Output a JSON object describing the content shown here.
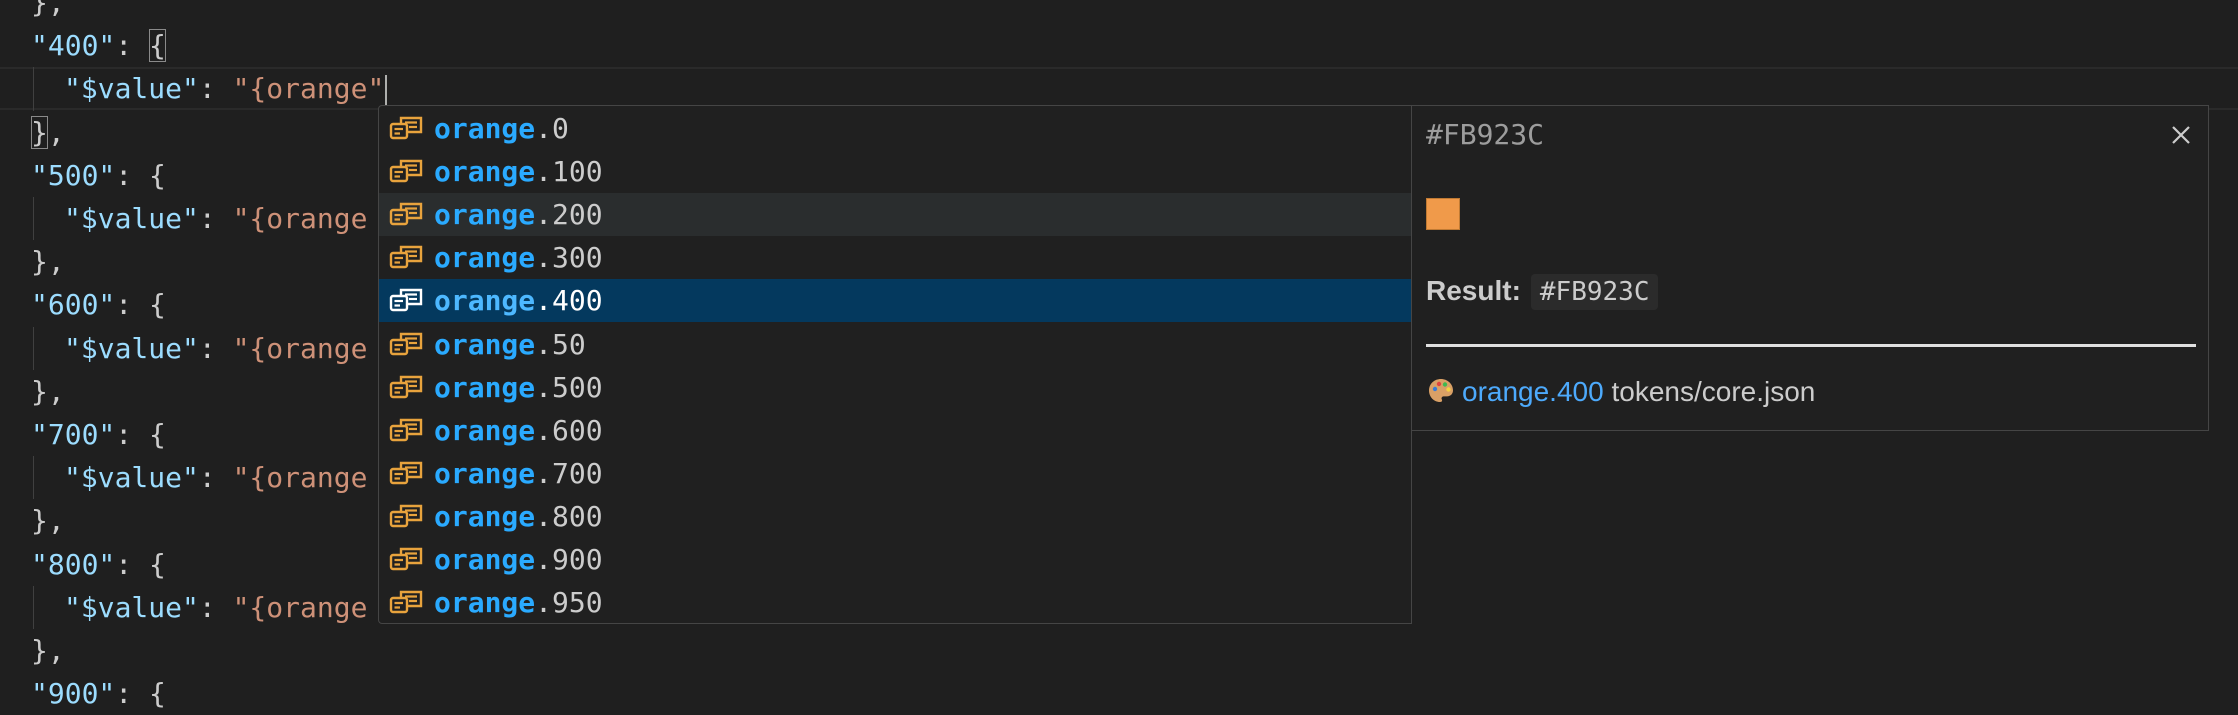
{
  "editor": {
    "lines": [
      {
        "kind": "close",
        "text": "},"
      },
      {
        "kind": "key",
        "key": "\"400\"",
        "sep": ": ",
        "brace": "{"
      },
      {
        "kind": "value",
        "vkey": "\"$value\"",
        "sep": ": ",
        "vstr": "\"{orange\""
      },
      {
        "kind": "close",
        "text": "},"
      },
      {
        "kind": "key",
        "key": "\"500\"",
        "sep": ": ",
        "brace": "{"
      },
      {
        "kind": "value",
        "vkey": "\"$value\"",
        "sep": ": ",
        "vstr": "\"{orange"
      },
      {
        "kind": "close",
        "text": "},"
      },
      {
        "kind": "key",
        "key": "\"600\"",
        "sep": ": ",
        "brace": "{"
      },
      {
        "kind": "value",
        "vkey": "\"$value\"",
        "sep": ": ",
        "vstr": "\"{orange"
      },
      {
        "kind": "close",
        "text": "},"
      },
      {
        "kind": "key",
        "key": "\"700\"",
        "sep": ": ",
        "brace": "{"
      },
      {
        "kind": "value",
        "vkey": "\"$value\"",
        "sep": ": ",
        "vstr": "\"{orange"
      },
      {
        "kind": "close",
        "text": "},"
      },
      {
        "kind": "key",
        "key": "\"800\"",
        "sep": ": ",
        "brace": "{"
      },
      {
        "kind": "value",
        "vkey": "\"$value\"",
        "sep": ": ",
        "vstr": "\"{orange"
      },
      {
        "kind": "close",
        "text": "},"
      },
      {
        "kind": "key",
        "key": "\"900\"",
        "sep": ": ",
        "brace": "{"
      }
    ]
  },
  "suggest": {
    "match": "orange",
    "items": [
      {
        "suffix": ".0",
        "state": "normal"
      },
      {
        "suffix": ".100",
        "state": "normal"
      },
      {
        "suffix": ".200",
        "state": "hover"
      },
      {
        "suffix": ".300",
        "state": "normal"
      },
      {
        "suffix": ".400",
        "state": "selected"
      },
      {
        "suffix": ".50",
        "state": "normal"
      },
      {
        "suffix": ".500",
        "state": "normal"
      },
      {
        "suffix": ".600",
        "state": "normal"
      },
      {
        "suffix": ".700",
        "state": "normal"
      },
      {
        "suffix": ".800",
        "state": "normal"
      },
      {
        "suffix": ".900",
        "state": "normal"
      },
      {
        "suffix": ".950",
        "state": "normal"
      }
    ],
    "icon": "variable-icon",
    "icon_color": "#e8a33d"
  },
  "details": {
    "title": "#FB923C",
    "swatch_color": "#f09a4a",
    "result_label": "Result:",
    "result_value": "#FB923C",
    "source_emoji_icon": "palette-icon",
    "token_name": "orange.400",
    "file_path": "tokens/core.json",
    "close_icon": "close-icon"
  },
  "colors": {
    "editor_bg": "#1f1f1f",
    "key": "#9cdcfe",
    "string": "#ce9178",
    "selected_bg": "#04395e",
    "highlight": "#2aaaff"
  }
}
